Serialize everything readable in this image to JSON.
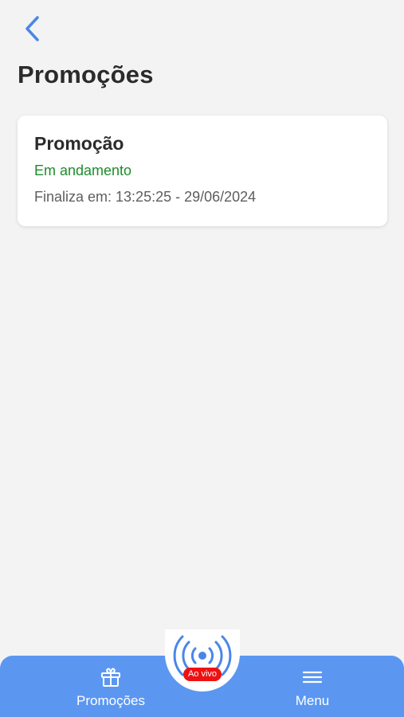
{
  "header": {
    "title": "Promoções"
  },
  "promotions": [
    {
      "title": "Promoção",
      "status": "Em andamento",
      "ends": "Finaliza em: 13:25:25 - 29/06/2024"
    }
  ],
  "live": {
    "badge": "Ao vivo"
  },
  "nav": {
    "promos_label": "Promoções",
    "menu_label": "Menu"
  },
  "colors": {
    "accent": "#5b97f1",
    "status": "#1e8c2a",
    "live_badge": "#ee1111"
  },
  "icons": {
    "back": "chevron-left-icon",
    "gift": "gift-icon",
    "menu": "hamburger-icon",
    "live": "broadcast-icon"
  }
}
